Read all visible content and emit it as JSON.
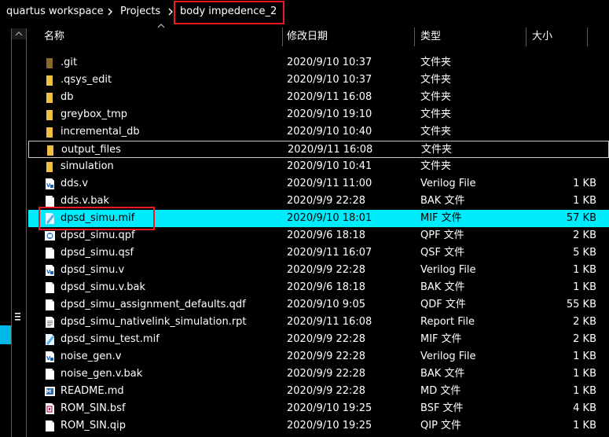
{
  "breadcrumb": {
    "items": [
      "quartus workspace",
      "Projects",
      "body impedence_2"
    ]
  },
  "columns": {
    "name": "名称",
    "date": "修改日期",
    "type": "类型",
    "size": "大小"
  },
  "colors": {
    "selection": "#00ecfd",
    "highlight_box": "#e81b23",
    "folder": "#f0c040",
    "nav_accent": "#00b8e6"
  },
  "files": [
    {
      "name": ".git",
      "date": "2020/9/10 10:37",
      "type": "文件夹",
      "size": "",
      "icon": "folder-icon"
    },
    {
      "name": ".qsys_edit",
      "date": "2020/9/10 10:37",
      "type": "文件夹",
      "size": "",
      "icon": "folder-icon"
    },
    {
      "name": "db",
      "date": "2020/9/11 16:08",
      "type": "文件夹",
      "size": "",
      "icon": "folder-icon"
    },
    {
      "name": "greybox_tmp",
      "date": "2020/9/10 19:10",
      "type": "文件夹",
      "size": "",
      "icon": "folder-icon"
    },
    {
      "name": "incremental_db",
      "date": "2020/9/10 10:40",
      "type": "文件夹",
      "size": "",
      "icon": "folder-icon"
    },
    {
      "name": "output_files",
      "date": "2020/9/11 16:08",
      "type": "文件夹",
      "size": "",
      "icon": "folder-icon"
    },
    {
      "name": "simulation",
      "date": "2020/9/10 10:41",
      "type": "文件夹",
      "size": "",
      "icon": "folder-icon"
    },
    {
      "name": "dds.v",
      "date": "2020/9/11 11:00",
      "type": "Verilog File",
      "size": "1 KB",
      "icon": "verilog-file-icon"
    },
    {
      "name": "dds.v.bak",
      "date": "2020/9/9 22:28",
      "type": "BAK 文件",
      "size": "1 KB",
      "icon": "blank-file-icon"
    },
    {
      "name": "dpsd_simu.mif",
      "date": "2020/9/10 18:01",
      "type": "MIF 文件",
      "size": "57 KB",
      "icon": "mif-file-icon"
    },
    {
      "name": "dpsd_simu.qpf",
      "date": "2020/9/6 18:18",
      "type": "QPF 文件",
      "size": "2 KB",
      "icon": "qpf-file-icon"
    },
    {
      "name": "dpsd_simu.qsf",
      "date": "2020/9/11 16:07",
      "type": "QSF 文件",
      "size": "5 KB",
      "icon": "blank-file-icon"
    },
    {
      "name": "dpsd_simu.v",
      "date": "2020/9/9 22:28",
      "type": "Verilog File",
      "size": "1 KB",
      "icon": "verilog-file-icon"
    },
    {
      "name": "dpsd_simu.v.bak",
      "date": "2020/9/6 18:18",
      "type": "BAK 文件",
      "size": "1 KB",
      "icon": "blank-file-icon"
    },
    {
      "name": "dpsd_simu_assignment_defaults.qdf",
      "date": "2020/9/10 9:05",
      "type": "QDF 文件",
      "size": "55 KB",
      "icon": "blank-file-icon"
    },
    {
      "name": "dpsd_simu_nativelink_simulation.rpt",
      "date": "2020/9/11 16:08",
      "type": "Report File",
      "size": "2 KB",
      "icon": "report-file-icon"
    },
    {
      "name": "dpsd_simu_test.mif",
      "date": "2020/9/9 22:28",
      "type": "MIF 文件",
      "size": "2 KB",
      "icon": "mif-file-icon"
    },
    {
      "name": "noise_gen.v",
      "date": "2020/9/9 22:28",
      "type": "Verilog File",
      "size": "1 KB",
      "icon": "verilog-file-icon"
    },
    {
      "name": "noise_gen.v.bak",
      "date": "2020/9/9 22:28",
      "type": "BAK 文件",
      "size": "1 KB",
      "icon": "blank-file-icon"
    },
    {
      "name": "README.md",
      "date": "2020/9/9 22:28",
      "type": "MD 文件",
      "size": "1 KB",
      "icon": "md-file-icon"
    },
    {
      "name": "ROM_SIN.bsf",
      "date": "2020/9/10 19:25",
      "type": "BSF 文件",
      "size": "4 KB",
      "icon": "bsf-file-icon"
    },
    {
      "name": "ROM_SIN.qip",
      "date": "2020/9/10 19:25",
      "type": "QIP 文件",
      "size": "1 KB",
      "icon": "blank-file-icon"
    }
  ]
}
